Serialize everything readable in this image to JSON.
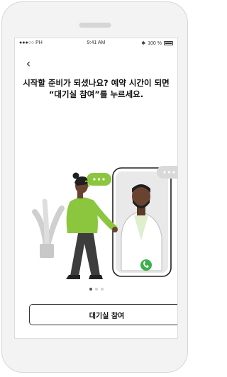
{
  "status": {
    "carrier": "●●●○○ PH",
    "time": "9:41 AM",
    "battery": "100 %"
  },
  "header": {
    "back_icon": "chevron-left-icon",
    "title": "시작할 준비가 되셨나요? 예약 시간이 되면 “대기실 참여”를 누르세요."
  },
  "pagination": {
    "count": 3,
    "active_index": 0
  },
  "actions": {
    "join_label": "대기실 참여"
  },
  "colors": {
    "accent_green": "#8cc63f",
    "call_green": "#3cb04a",
    "bubble_gray": "#d9d9d9"
  }
}
